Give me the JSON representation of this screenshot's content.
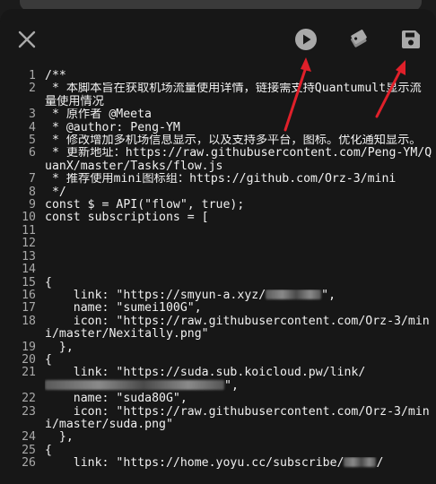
{
  "toolbar": {
    "close_icon": "close-icon",
    "run_icon": "play-circle-icon",
    "tag_icon": "tags-icon",
    "save_icon": "save-icon"
  },
  "editor": {
    "lines": [
      {
        "n": "1",
        "t": "/**"
      },
      {
        "n": "2",
        "t": " * 本脚本旨在获取机场流量使用详情，链接需支持Quantumult显示流量使用情况"
      },
      {
        "n": "3",
        "t": " * 原作者 @Meeta"
      },
      {
        "n": "4",
        "t": " * @author: Peng-YM"
      },
      {
        "n": "5",
        "t": " * 修改增加多机场信息显示，以及支持多平台，图标。优化通知显示。"
      },
      {
        "n": "6",
        "t": " * 更新地址：https://raw.githubusercontent.com/Peng-YM/QuanX/master/Tasks/flow.js"
      },
      {
        "n": "7",
        "t": " * 推荐使用mini图标组：https://github.com/Orz-3/mini"
      },
      {
        "n": "8",
        "t": " */"
      },
      {
        "n": "9",
        "t": "const $ = API(\"flow\", true);"
      },
      {
        "n": "10",
        "t": "const subscriptions = ["
      },
      {
        "n": "11",
        "t": ""
      },
      {
        "n": "12",
        "t": ""
      },
      {
        "n": "13",
        "t": ""
      },
      {
        "n": "14",
        "t": ""
      },
      {
        "n": "15",
        "t": "{"
      },
      {
        "n": "16",
        "t": "    link: \"https://smyun-a.xyz/",
        "blur": 62,
        "after": "\","
      },
      {
        "n": "17",
        "t": "    name: \"sumei100G\","
      },
      {
        "n": "18",
        "t": "    icon: \"https://raw.githubusercontent.com/Orz-3/mini/master/Nexitally.png\""
      },
      {
        "n": "19",
        "t": "  },"
      },
      {
        "n": "20",
        "t": "{"
      },
      {
        "n": "21",
        "t": "    link: \"https://suda.sub.koicloud.pw/link/",
        "blur": 200,
        "after": "\","
      },
      {
        "n": "22",
        "t": "    name: \"suda80G\","
      },
      {
        "n": "23",
        "t": "    icon: \"https://raw.githubusercontent.com/Orz-3/mini/master/suda.png\""
      },
      {
        "n": "24",
        "t": "  },"
      },
      {
        "n": "25",
        "t": "{"
      },
      {
        "n": "26",
        "t": "    link: \"https://home.yoyu.cc/subscribe/",
        "blur": 36,
        "after": "/"
      }
    ],
    "line_numbers_color": "#a8a8a8",
    "text_color": "#f0f0f0",
    "background": "#171717"
  },
  "annotation_color": "#e0202a"
}
